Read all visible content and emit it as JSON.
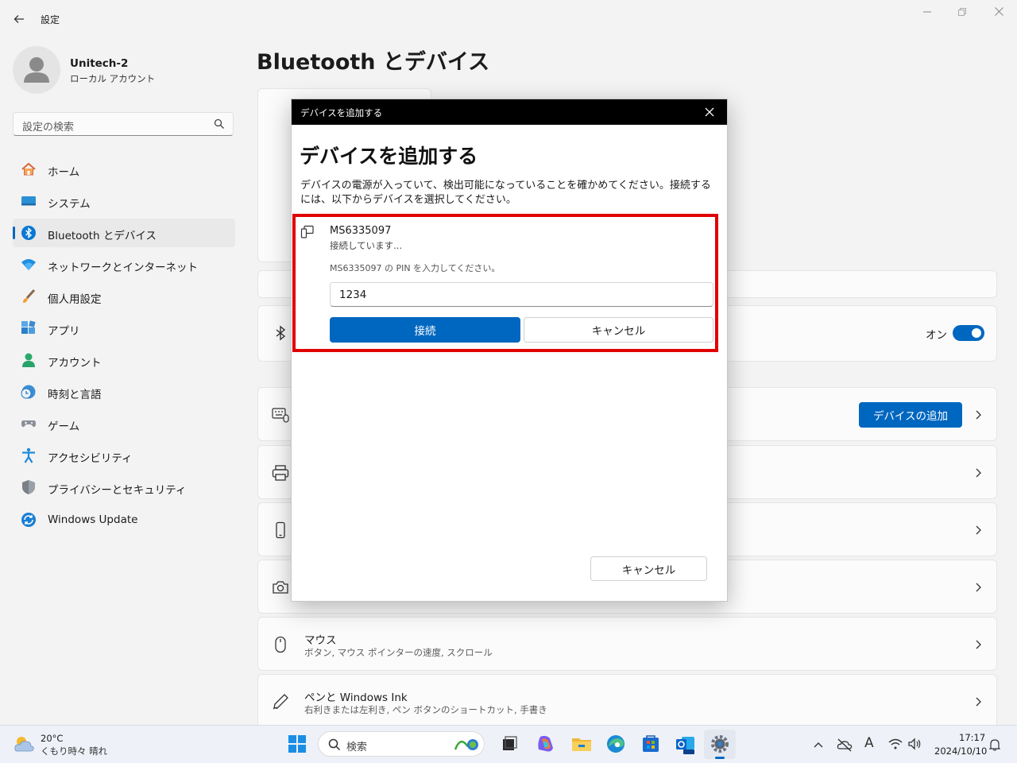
{
  "window": {
    "title": "設定",
    "controls": [
      "minimize-icon",
      "restore-icon",
      "close-icon"
    ]
  },
  "user": {
    "name": "Unitech-2",
    "account_type": "ローカル アカウント"
  },
  "search": {
    "placeholder": "設定の検索"
  },
  "nav": {
    "items": [
      {
        "label": "ホーム",
        "icon": "home-icon"
      },
      {
        "label": "システム",
        "icon": "system-icon"
      },
      {
        "label": "Bluetooth とデバイス",
        "icon": "bluetooth-icon",
        "selected": true
      },
      {
        "label": "ネットワークとインターネット",
        "icon": "wifi-icon"
      },
      {
        "label": "個人用設定",
        "icon": "brush-icon"
      },
      {
        "label": "アプリ",
        "icon": "apps-icon"
      },
      {
        "label": "アカウント",
        "icon": "account-icon"
      },
      {
        "label": "時刻と言語",
        "icon": "time-language-icon"
      },
      {
        "label": "ゲーム",
        "icon": "gamepad-icon"
      },
      {
        "label": "アクセシビリティ",
        "icon": "accessibility-icon"
      },
      {
        "label": "プライバシーとセキュリティ",
        "icon": "shield-icon"
      },
      {
        "label": "Windows Update",
        "icon": "update-icon"
      }
    ]
  },
  "page": {
    "title": "Bluetooth とデバイス",
    "bluetooth_toggle_label": "オン",
    "add_device_button": "デバイスの追加",
    "mouse_title": "マウス",
    "mouse_sub": "ボタン, マウス ポインターの速度, スクロール",
    "pen_title": "ペンと Windows Ink",
    "pen_sub": "右利きまたは左利き, ペン ボタンのショートカット, 手書き"
  },
  "dialog": {
    "bar_title": "デバイスを追加する",
    "heading": "デバイスを追加する",
    "description": "デバイスの電源が入っていて、検出可能になっていることを確かめてください。接続するには、以下からデバイスを選択してください。",
    "device_name": "MS6335097",
    "device_status": "接続しています...",
    "pin_prompt": "MS6335097 の PIN を入力してください。",
    "pin_value": "1234",
    "connect_button": "接続",
    "cancel_button": "キャンセル",
    "bottom_cancel_button": "キャンセル"
  },
  "taskbar": {
    "weather_temp": "20°C",
    "weather_desc": "くもり時々 晴れ",
    "search_placeholder": "検索",
    "ime_indicator": "A",
    "time": "17:17",
    "date": "2024/10/10"
  },
  "colors": {
    "accent": "#0067c0",
    "highlight_border": "#e00000",
    "dialog_titlebar": "#000000"
  }
}
